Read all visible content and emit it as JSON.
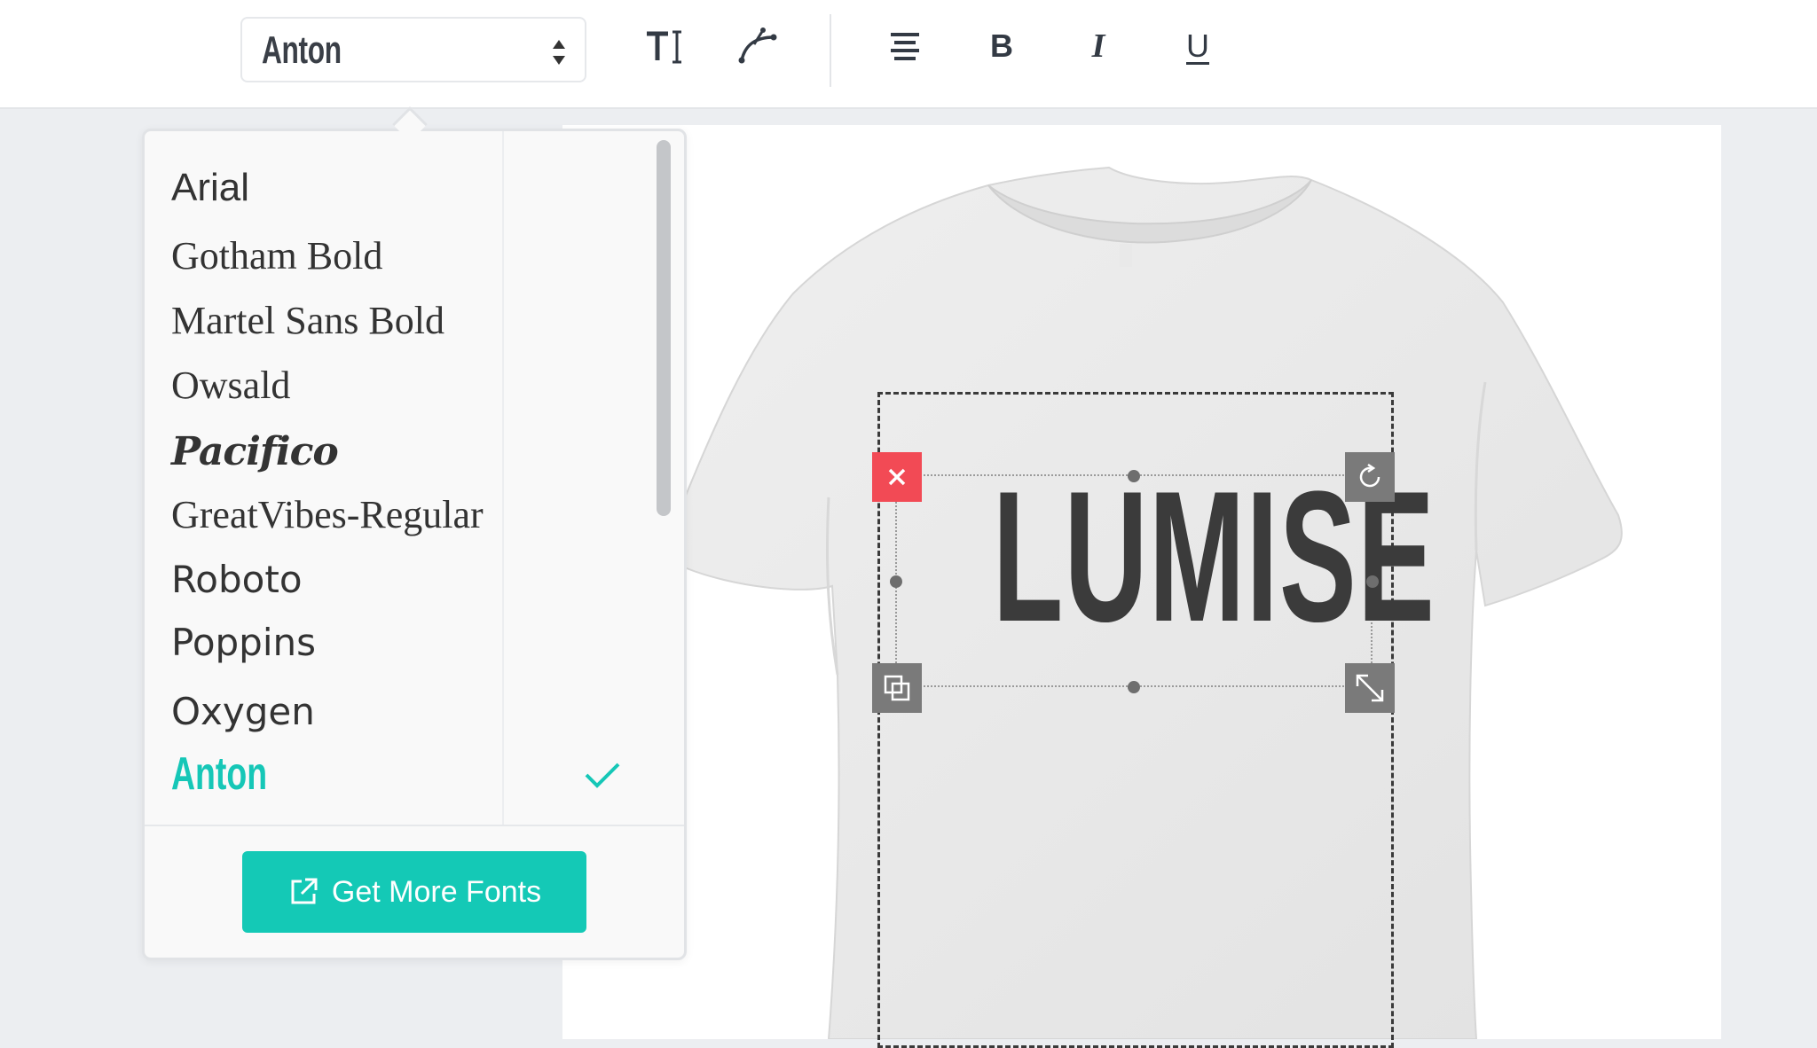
{
  "toolbar": {
    "font_select": {
      "selected": "Anton"
    },
    "tools": [
      {
        "id": "text-size",
        "icon": "text-size-icon"
      },
      {
        "id": "curved-text",
        "icon": "curve-icon"
      },
      {
        "id": "align",
        "icon": "align-center-icon"
      },
      {
        "id": "bold",
        "label": "B"
      },
      {
        "id": "italic",
        "label": "I"
      },
      {
        "id": "underline",
        "label": "U"
      }
    ]
  },
  "font_dropdown": {
    "fonts": [
      {
        "label": "Arial"
      },
      {
        "label": "Gotham Bold"
      },
      {
        "label": "Martel Sans Bold"
      },
      {
        "label": "Owsald"
      },
      {
        "label": "Pacifico"
      },
      {
        "label": "GreatVibes-Regular"
      },
      {
        "label": "Roboto"
      },
      {
        "label": "Poppins"
      },
      {
        "label": "Oxygen"
      },
      {
        "label": "Anton",
        "selected": true
      }
    ],
    "get_more_label": "Get More Fonts"
  },
  "canvas": {
    "text": "LUMISE",
    "controls": [
      "close-icon",
      "rotate-icon",
      "duplicate-icon",
      "resize-icon"
    ]
  },
  "colors": {
    "accent": "#14c9b6",
    "delete": "#f24a55",
    "control": "#7a7a7a",
    "text_dark": "#3b3b3b"
  }
}
